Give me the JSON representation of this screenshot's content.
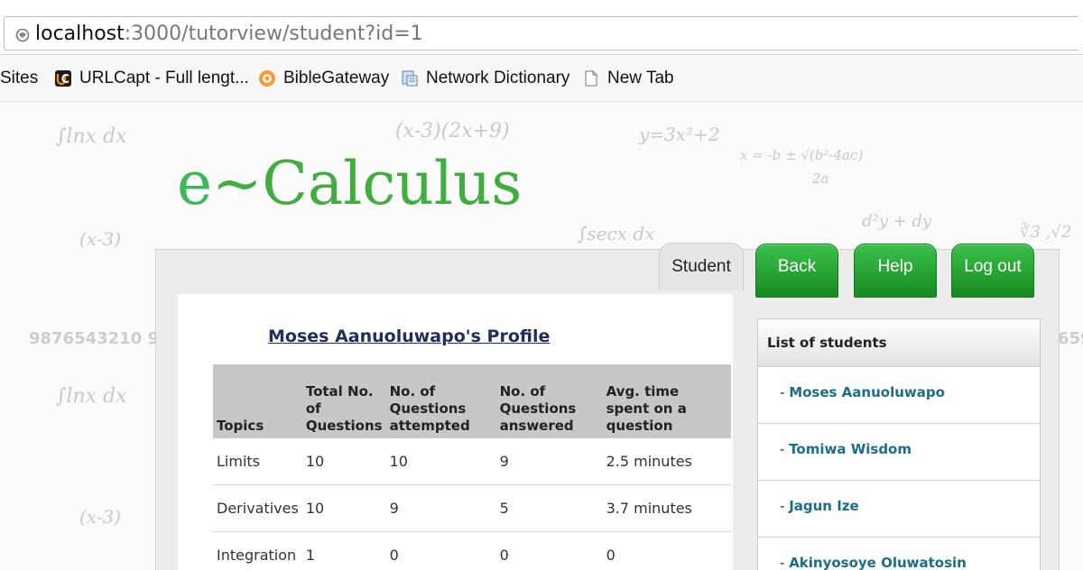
{
  "browser": {
    "url_host": "localhost",
    "url_rest": ":3000/tutorview/student?id=1",
    "icons": {
      "address": "globe-icon"
    }
  },
  "bookmarks": {
    "items": [
      {
        "label": "Sites",
        "icon": ""
      },
      {
        "label": "URLCapt - Full lengt...",
        "icon": "urlcapt-icon"
      },
      {
        "label": "BibleGateway",
        "icon": "biblegateway-icon"
      },
      {
        "label": "Network Dictionary",
        "icon": "network-dictionary-icon"
      },
      {
        "label": "New Tab",
        "icon": "page-icon"
      }
    ]
  },
  "site": {
    "logo_e": "e",
    "logo_rest": "~Calculus",
    "tabs": {
      "student": "Student"
    },
    "buttons": {
      "back": "Back",
      "help": "Help",
      "logout": "Log out"
    },
    "accent": "#2aa43a"
  },
  "profile": {
    "title": "Moses Aanuoluwapo's Profile",
    "headers": {
      "topics": "Topics",
      "total_a": "Total No.",
      "total_b": "of",
      "total_c": "Questions",
      "attempted_a": "No. of",
      "attempted_b": "Questions",
      "attempted_c": "attempted",
      "answered_a": "No. of",
      "answered_b": "Questions",
      "answered_c": "answered",
      "avg_a": "Avg. time",
      "avg_b": "spent on a",
      "avg_c": "question"
    },
    "rows": [
      {
        "topic": "Limits",
        "total": "10",
        "attempted": "10",
        "answered": "9",
        "avg": "2.5 minutes"
      },
      {
        "topic": "Derivatives",
        "total": "10",
        "attempted": "9",
        "answered": "5",
        "avg": "3.7 minutes"
      },
      {
        "topic": "Integration",
        "total": "1",
        "attempted": "0",
        "answered": "0",
        "avg": "0"
      }
    ]
  },
  "students": {
    "title": "List of students",
    "items": [
      {
        "name": "Moses Aanuoluwapo"
      },
      {
        "name": "Tomiwa Wisdom"
      },
      {
        "name": "Jagun Ize"
      },
      {
        "name": "Akinyosoye Oluwatosin"
      }
    ]
  },
  "background_math": {
    "f1": "∫lnx dx",
    "f2": "(x-3)(2x+9)",
    "f3": "y=3x²+2",
    "f4": "x = -b ± √(b²-4ac)",
    "f4b": "2a",
    "f5": "(x-3)",
    "f6": "∫secx dx",
    "f7": "d²y + dy",
    "f8": "∛3 ,√2",
    "f9": "9876543210  9",
    "f10": "∫lnx dx",
    "f11": "(x-3)",
    "f12": "659"
  }
}
